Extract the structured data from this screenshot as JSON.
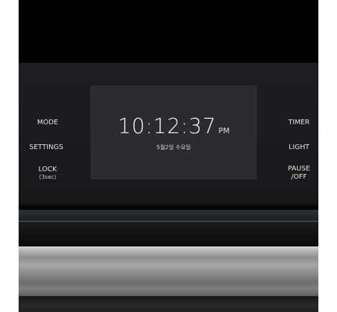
{
  "controls": {
    "mode": "MODE",
    "settings": "SETTINGS",
    "lock": "LOCK",
    "lock_hint": "(3sec)",
    "timer": "TIMER",
    "light": "LIGHT",
    "pause_off_line1": "PAUSE",
    "pause_off_line2": "/OFF"
  },
  "display": {
    "time": "10:12:37",
    "ampm": "PM",
    "date": "5월2일 수요일"
  },
  "colors": {
    "panel": "#1c1d20",
    "screen": "#2b2c2f",
    "text": "#e6e6e6",
    "handle": "#9a9a9a"
  }
}
